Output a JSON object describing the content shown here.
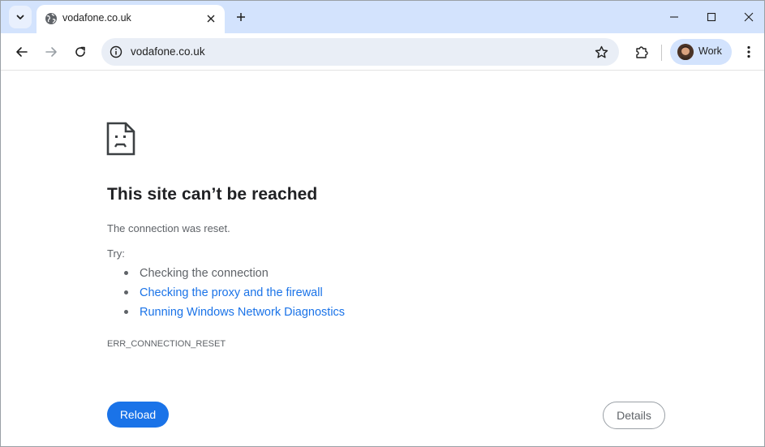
{
  "tab": {
    "title": "vodafone.co.uk",
    "favicon": "globe-icon"
  },
  "omnibox": {
    "url": "vodafone.co.uk"
  },
  "profile": {
    "label": "Work"
  },
  "error": {
    "heading": "This site can’t be reached",
    "message": "The connection was reset.",
    "try_label": "Try:",
    "suggestions": [
      {
        "text": "Checking the connection",
        "link": false
      },
      {
        "text": "Checking the proxy and the firewall",
        "link": true
      },
      {
        "text": "Running Windows Network Diagnostics",
        "link": true
      }
    ],
    "code": "ERR_CONNECTION_RESET"
  },
  "buttons": {
    "reload": "Reload",
    "details": "Details"
  },
  "colors": {
    "accent": "#1a73e8",
    "tabstrip": "#d3e3fd",
    "omnibox": "#e9eef6",
    "muted_text": "#5f6368"
  }
}
